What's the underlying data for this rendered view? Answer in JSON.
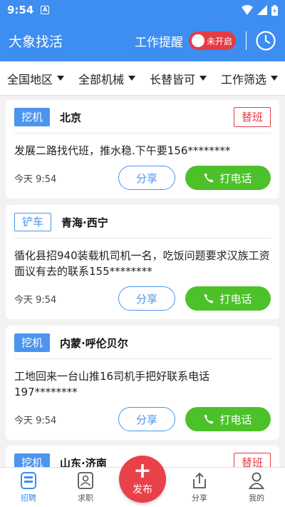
{
  "status_bar": {
    "time": "9:54",
    "notif_letter": "A"
  },
  "app_bar": {
    "title": "大象找活",
    "reminder_label": "工作提醒",
    "toggle_text": "未开启"
  },
  "filters": [
    {
      "label": "全国地区"
    },
    {
      "label": "全部机械"
    },
    {
      "label": "长替皆可"
    },
    {
      "label": "工作筛选"
    }
  ],
  "cards": [
    {
      "tag": "挖机",
      "location": "北京",
      "badge": "替班",
      "text": "发展二路找代班，推水稳.下午要156********",
      "time": "今天 9:54",
      "share": "分享",
      "call": "打电话"
    },
    {
      "tag": "铲车",
      "location": "青海·西宁",
      "text": "循化县招940装载机司机一名，吃饭问题要求汉族工资面议有去的联系155********",
      "time": "今天 9:54",
      "share": "分享",
      "call": "打电话"
    },
    {
      "tag": "挖机",
      "location": "内蒙·呼伦贝尔",
      "text": "工地回来一台山推16司机手把好联系电话197********",
      "time": "今天 9:54",
      "share": "分享",
      "call": "打电话"
    },
    {
      "tag": "挖机",
      "location": "山东·济南",
      "badge": "替班"
    }
  ],
  "bottom_nav": {
    "recruit": "招聘",
    "jobseek": "求职",
    "publish": "发布",
    "share": "分享",
    "mine": "我的"
  },
  "colors": {
    "primary": "#3d8ef0",
    "call_green": "#4cc129",
    "alert_red": "#e53b43"
  }
}
